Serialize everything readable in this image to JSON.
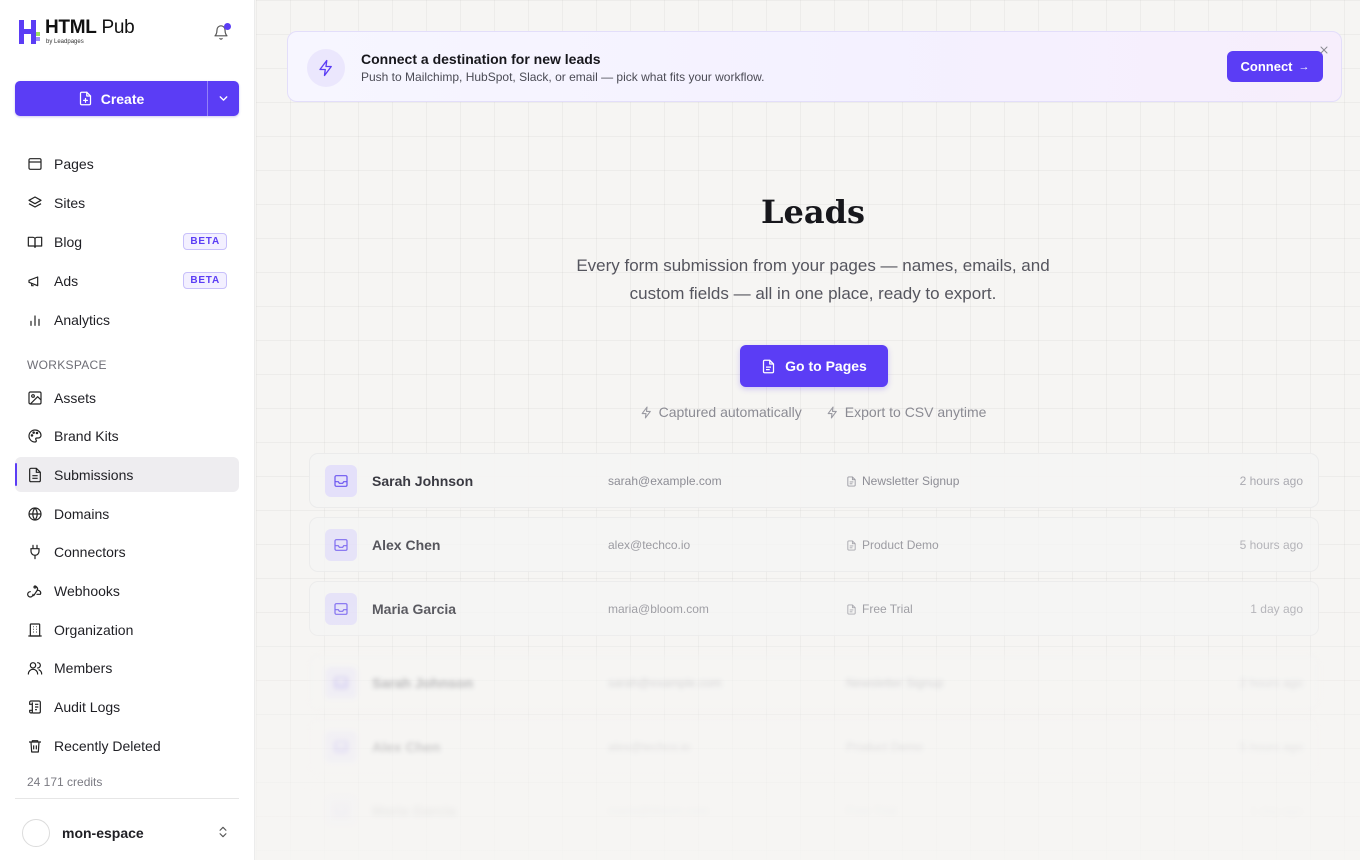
{
  "app": {
    "logo_title_bold": "HTML",
    "logo_title_light": " Pub",
    "logo_subtitle": "by Leadpages",
    "brand_color": "#5b3df5"
  },
  "sidebar": {
    "create_label": "Create",
    "primary_items": [
      {
        "label": "Pages",
        "icon": "browser-icon"
      },
      {
        "label": "Sites",
        "icon": "layers-icon"
      },
      {
        "label": "Blog",
        "icon": "book-icon",
        "badge": "BETA"
      },
      {
        "label": "Ads",
        "icon": "megaphone-icon",
        "badge": "BETA"
      },
      {
        "label": "Analytics",
        "icon": "bar-chart-icon"
      }
    ],
    "section_label": "WORKSPACE",
    "workspace_items": [
      {
        "label": "Assets",
        "icon": "image-icon"
      },
      {
        "label": "Brand Kits",
        "icon": "palette-icon"
      },
      {
        "label": "Submissions",
        "icon": "file-text-icon",
        "active": true
      },
      {
        "label": "Domains",
        "icon": "globe-icon"
      },
      {
        "label": "Connectors",
        "icon": "plug-icon"
      },
      {
        "label": "Webhooks",
        "icon": "webhook-icon"
      },
      {
        "label": "Organization",
        "icon": "building-icon"
      },
      {
        "label": "Members",
        "icon": "users-icon"
      },
      {
        "label": "Audit Logs",
        "icon": "scroll-icon"
      },
      {
        "label": "Recently Deleted",
        "icon": "trash-icon"
      }
    ],
    "credits": "24 171 credits",
    "workspace_name": "mon-espace"
  },
  "banner": {
    "title": "Connect a destination for new leads",
    "text": "Push to Mailchimp, HubSpot, Slack, or email — pick what fits your workflow.",
    "button_label": "Connect",
    "button_arrow": "→"
  },
  "hero": {
    "title": "Leads",
    "subtitle": "Every form submission from your pages — names, emails, and custom fields — all in one place, ready to export.",
    "cta_label": "Go to Pages",
    "features": [
      "Captured automatically",
      "Export to CSV anytime"
    ]
  },
  "leads": [
    {
      "name": "Sarah Johnson",
      "email": "sarah@example.com",
      "form": "Newsletter Signup",
      "time": "2 hours ago"
    },
    {
      "name": "Alex Chen",
      "email": "alex@techco.io",
      "form": "Product Demo",
      "time": "5 hours ago"
    },
    {
      "name": "Maria Garcia",
      "email": "maria@bloom.com",
      "form": "Free Trial",
      "time": "1 day ago"
    },
    {
      "name": "Sarah Johnson",
      "email": "sarah@example.com",
      "form": "Newsletter Signup",
      "time": "2 hours ago"
    },
    {
      "name": "Alex Chen",
      "email": "alex@techco.io",
      "form": "Product Demo",
      "time": "5 hours ago"
    },
    {
      "name": "Maria Garcia",
      "email": "maria@bloom.com",
      "form": "Free Trial",
      "time": "1 day ago"
    }
  ]
}
